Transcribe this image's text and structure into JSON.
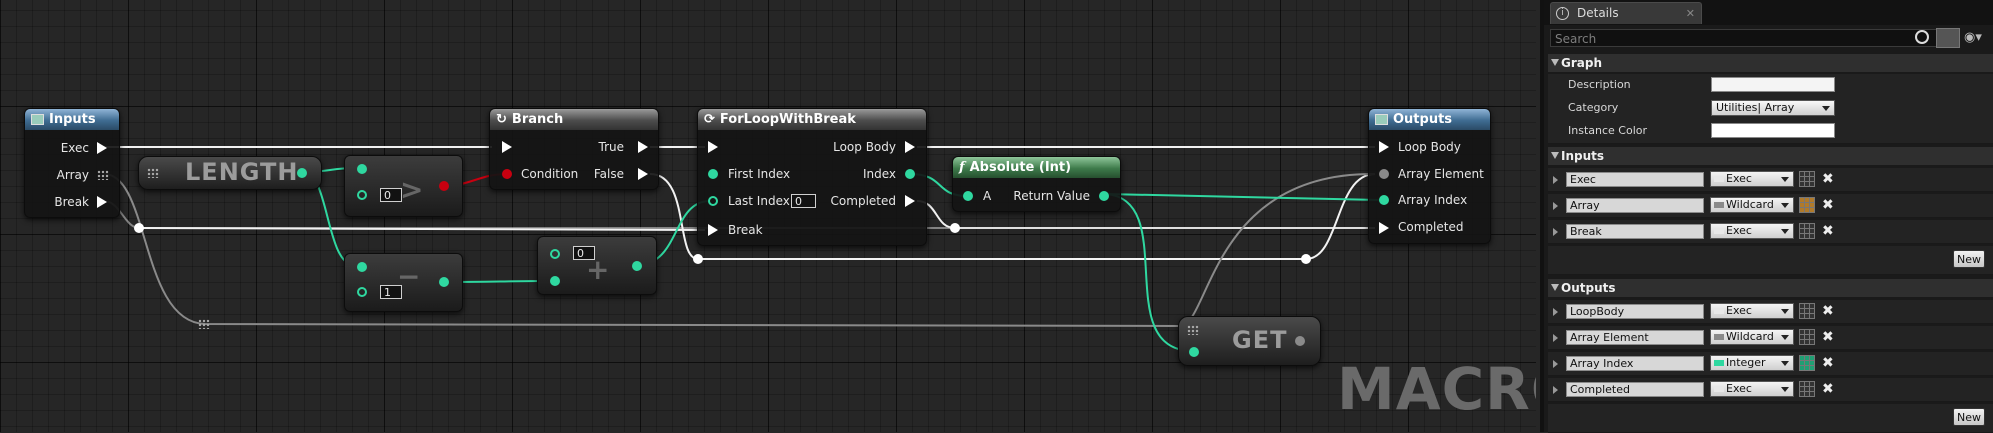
{
  "graph": {
    "watermark": "MACRO",
    "nodes": {
      "inputs": {
        "title": "Inputs",
        "exec": "Exec",
        "array": "Array",
        "break": "Break"
      },
      "length": {
        "title": "LENGTH"
      },
      "greater": {
        "value": "0"
      },
      "subtract": {
        "value": "1"
      },
      "add": {
        "value": "0"
      },
      "branch": {
        "title": "Branch",
        "condition": "Condition",
        "true": "True",
        "false": "False"
      },
      "forloop": {
        "title": "ForLoopWithBreak",
        "first_index": "First Index",
        "last_index": "Last Index",
        "last_index_value": "0",
        "break": "Break",
        "loop_body": "Loop Body",
        "index": "Index",
        "completed": "Completed"
      },
      "absolute": {
        "title": "Absolute (Int)",
        "a": "A",
        "return_value": "Return Value"
      },
      "get": {
        "title": "GET"
      },
      "outputs": {
        "title": "Outputs",
        "loop_body": "Loop Body",
        "array_element": "Array Element",
        "array_index": "Array Index",
        "completed": "Completed"
      }
    }
  },
  "details": {
    "tab_title": "Details",
    "search_placeholder": "Search",
    "graph_section": "Graph",
    "description_label": "Description",
    "description_value": "",
    "category_label": "Category",
    "category_value": "Utilities| Array",
    "instance_color_label": "Instance Color",
    "inputs_section": "Inputs",
    "inputs": [
      {
        "name": "Exec",
        "type": "Exec",
        "color": "#e8e8e8"
      },
      {
        "name": "Array",
        "type": "Wildcard",
        "color": "#8a8a8a"
      },
      {
        "name": "Break",
        "type": "Exec",
        "color": "#e8e8e8"
      }
    ],
    "outputs_section": "Outputs",
    "outputs": [
      {
        "name": "LoopBody",
        "type": "Exec",
        "color": "#e8e8e8"
      },
      {
        "name": "Array Element",
        "type": "Wildcard",
        "color": "#8a8a8a"
      },
      {
        "name": "Array Index",
        "type": "Integer",
        "color": "#2fd8a0"
      },
      {
        "name": "Completed",
        "type": "Exec",
        "color": "#e8e8e8"
      }
    ],
    "new_label": "New"
  }
}
